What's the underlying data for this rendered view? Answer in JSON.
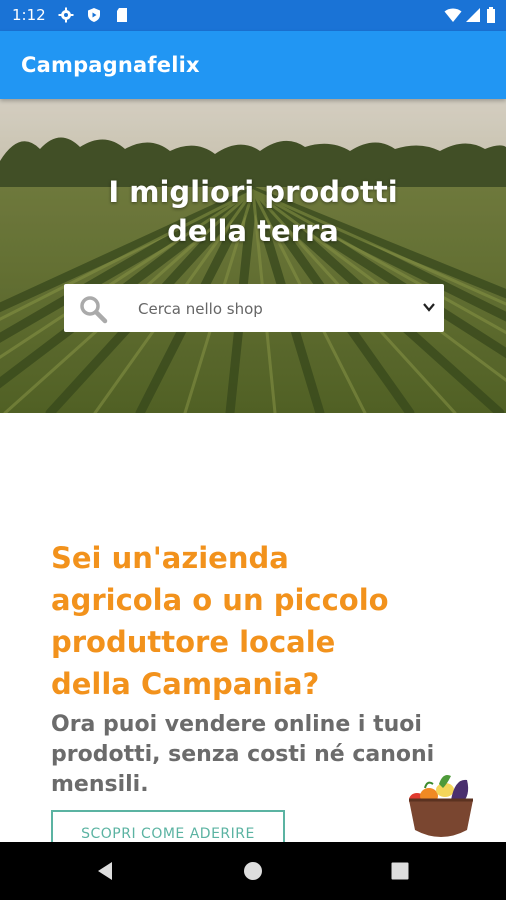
{
  "status_bar": {
    "time": "1:12",
    "left_icons": [
      "gear-icon",
      "shield-icon",
      "sd-card-icon"
    ],
    "right_icons": [
      "wifi-icon",
      "signal-icon",
      "battery-icon"
    ]
  },
  "app_bar": {
    "title": "Campagnafelix"
  },
  "hero": {
    "title_line1": "I migliori prodotti",
    "title_line2": "della terra",
    "search": {
      "placeholder": "Cerca nello shop"
    }
  },
  "promo": {
    "heading_lines": [
      "Sei un'azienda",
      "agricola o un piccolo",
      "produttore locale",
      "della Campania?"
    ],
    "sub_lines": [
      "Ora puoi vendere online i tuoi",
      "prodotti, senza costi né canoni",
      "mensili."
    ],
    "cta_label": "SCOPRI COME ADERIRE"
  },
  "navigation": {
    "buttons": [
      "back-icon",
      "home-icon",
      "recents-icon"
    ]
  },
  "colors": {
    "app_bar": "#2196f3",
    "status_bar": "#1a73d6",
    "heading_orange": "#f2921c",
    "sub_gray": "#6b6b6b",
    "cta_teal": "#5bb3a2"
  }
}
